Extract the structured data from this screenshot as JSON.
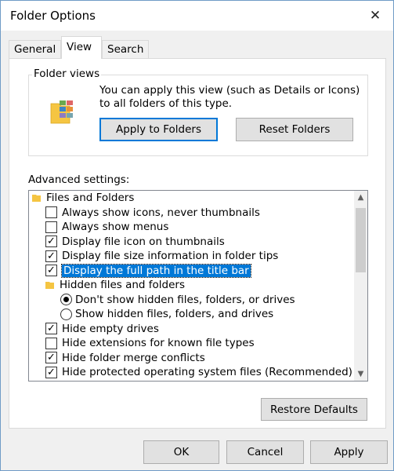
{
  "window": {
    "title": "Folder Options"
  },
  "tabs": [
    {
      "label": "General"
    },
    {
      "label": "View"
    },
    {
      "label": "Search"
    }
  ],
  "folder_views": {
    "label": "Folder views",
    "description": "You can apply this view (such as Details or Icons) to all folders of this type.",
    "apply_label": "Apply to Folders",
    "reset_label": "Reset Folders"
  },
  "advanced": {
    "label": "Advanced settings:",
    "items": [
      {
        "kind": "folder",
        "label": "Files and Folders"
      },
      {
        "kind": "checkbox",
        "checked": false,
        "label": "Always show icons, never thumbnails"
      },
      {
        "kind": "checkbox",
        "checked": false,
        "label": "Always show menus"
      },
      {
        "kind": "checkbox",
        "checked": true,
        "label": "Display file icon on thumbnails"
      },
      {
        "kind": "checkbox",
        "checked": true,
        "label": "Display file size information in folder tips"
      },
      {
        "kind": "checkbox",
        "checked": true,
        "label": "Display the full path in the title bar",
        "selected": true
      },
      {
        "kind": "folder",
        "label": "Hidden files and folders"
      },
      {
        "kind": "radio",
        "checked": true,
        "label": "Don't show hidden files, folders, or drives"
      },
      {
        "kind": "radio",
        "checked": false,
        "label": "Show hidden files, folders, and drives"
      },
      {
        "kind": "checkbox",
        "checked": true,
        "label": "Hide empty drives"
      },
      {
        "kind": "checkbox",
        "checked": false,
        "label": "Hide extensions for known file types"
      },
      {
        "kind": "checkbox",
        "checked": true,
        "label": "Hide folder merge conflicts"
      },
      {
        "kind": "checkbox",
        "checked": true,
        "label": "Hide protected operating system files (Recommended)"
      }
    ]
  },
  "restore_label": "Restore Defaults",
  "footer": {
    "ok_label": "OK",
    "cancel_label": "Cancel",
    "apply_label": "Apply"
  },
  "colors": {
    "accent": "#0078d7",
    "folder": "#f5c542"
  }
}
